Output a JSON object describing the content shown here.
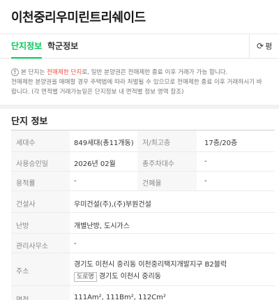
{
  "header": {
    "title": "이천중리우미린트리쉐이드"
  },
  "tabs": [
    {
      "label": "단지정보",
      "active": true
    },
    {
      "label": "학군정보",
      "active": false
    }
  ],
  "refresh": {
    "label": "평"
  },
  "notice": {
    "line1_prefix": "본 단지는 ",
    "line1_highlight": "전매제한 단지",
    "line1_suffix": "로, 일반 분양권은 전매제한 종료 이후 거래가 가능 합니다.",
    "line2": "전매제한 분양권을 매매할 경우 주택법에 따라 처벌될 수 있으므로 전매제한 종료 이후 거래하시기 바",
    "line3": "랍니다. (각 면적별 거래가능일은 단지정보 내 면적별 정보 영역 참조)"
  },
  "section": {
    "title": "단지 정보"
  },
  "info": {
    "households_label": "세대수",
    "households_value": "849세대(총11개동)",
    "floors_label": "저/최고층",
    "floors_value": "17층/20층",
    "approval_label": "사용승인일",
    "approval_value": "2026년 02월",
    "parking_label": "총주차대수",
    "parking_value": "-",
    "far_label": "용적률",
    "far_value": "-",
    "bcr_label": "건폐율",
    "bcr_value": "-",
    "builder_label": "건설사",
    "builder_value": "우미건설(주),(주)부원건설",
    "heating_label": "난방",
    "heating_value": "개별난방, 도시가스",
    "office_label": "관리사무소",
    "office_value": "-",
    "address_label": "주소",
    "address_line1": "경기도 이천시 중리동 이천중리택지개발지구 B2블럭",
    "address_tag": "도로명",
    "address_line2": "경기도 이천시 중리동",
    "area_label": "면적",
    "area_value": "111Am², 111Bm², 112Cm²"
  }
}
